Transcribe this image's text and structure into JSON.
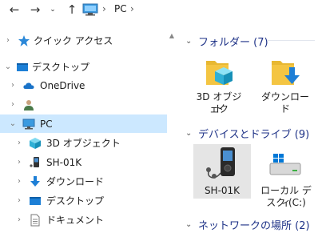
{
  "address": {
    "location": "PC"
  },
  "nav": {
    "quick_access": "クイック アクセス",
    "desktop_root": "デスクトップ",
    "onedrive": "OneDrive",
    "pc": "PC",
    "items": [
      "3D オブジェクト",
      "SH-01K",
      "ダウンロード",
      "デスクトップ",
      "ドキュメント"
    ]
  },
  "groups": {
    "folders": "フォルダー (7)",
    "devices": "デバイスとドライブ (9)",
    "network": "ネットワークの場所 (2)"
  },
  "tiles": {
    "objects3d_line1": "3D オブジェク",
    "objects3d_line2": "ト",
    "downloads": "ダウンロード",
    "sh01k": "SH-01K",
    "localdisk_line1": "ローカル ディ",
    "localdisk_line2": "スク (C:)"
  },
  "colors": {
    "selection": "#cce8ff",
    "group_title": "#1e3287",
    "folder_yellow": "#f4c542",
    "accent_blue": "#0078d7"
  }
}
